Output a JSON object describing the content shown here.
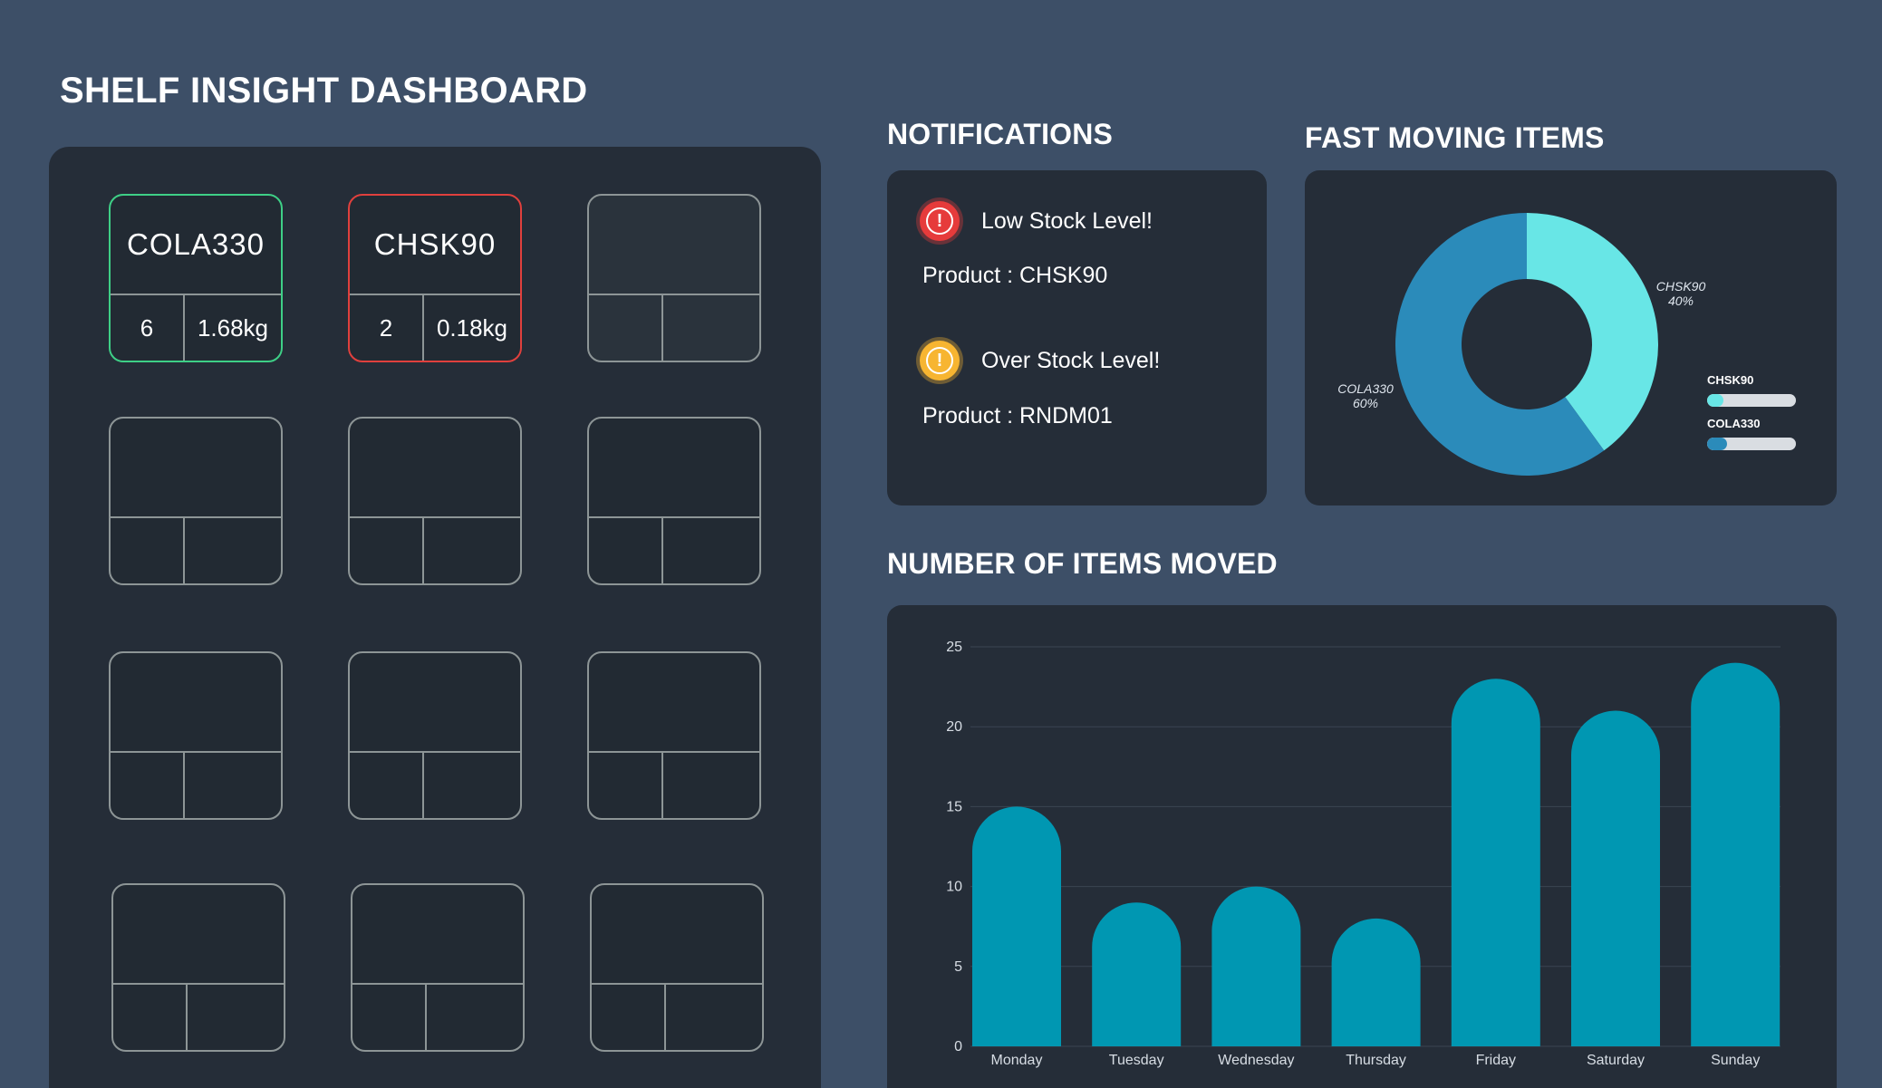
{
  "dashboard": {
    "title": "SHELF INSIGHT DASHBOARD"
  },
  "shelves": [
    {
      "code": "COLA330",
      "count": "6",
      "weight": "1.68kg",
      "status": "ok"
    },
    {
      "code": "CHSK90",
      "count": "2",
      "weight": "0.18kg",
      "status": "alert"
    },
    {
      "code": "",
      "count": "",
      "weight": "",
      "status": "empty"
    },
    {
      "code": "",
      "count": "",
      "weight": "",
      "status": "empty"
    },
    {
      "code": "",
      "count": "",
      "weight": "",
      "status": "empty"
    },
    {
      "code": "",
      "count": "",
      "weight": "",
      "status": "empty"
    },
    {
      "code": "",
      "count": "",
      "weight": "",
      "status": "empty"
    },
    {
      "code": "",
      "count": "",
      "weight": "",
      "status": "empty"
    },
    {
      "code": "",
      "count": "",
      "weight": "",
      "status": "empty"
    },
    {
      "code": "",
      "count": "",
      "weight": "",
      "status": "empty"
    },
    {
      "code": "",
      "count": "",
      "weight": "",
      "status": "empty"
    },
    {
      "code": "",
      "count": "",
      "weight": "",
      "status": "empty"
    }
  ],
  "notifications": {
    "title": "NOTIFICATIONS",
    "items": [
      {
        "message": "Low Stock Level!",
        "product": "Product : CHSK90",
        "level": "red",
        "icon": "alert-icon"
      },
      {
        "message": "Over Stock Level!",
        "product": "Product : RNDM01",
        "level": "yellow",
        "icon": "alert-icon"
      }
    ]
  },
  "fast_moving": {
    "title": "FAST MOVING ITEMS",
    "slices": [
      {
        "name": "CHSK90",
        "percent": 40,
        "label": "40%",
        "color": "#68e6e6"
      },
      {
        "name": "COLA330",
        "percent": 60,
        "label": "60%",
        "color": "#2b8bba"
      }
    ]
  },
  "items_moved": {
    "title": "NUMBER OF ITEMS MOVED"
  },
  "colors": {
    "background": "#3d4f67",
    "panel": "#252d38",
    "ok": "#3ecf86",
    "alert": "#e0403d",
    "bar": "#0097b2"
  },
  "chart_data": {
    "type": "bar",
    "categories": [
      "Monday",
      "Tuesday",
      "Wednesday",
      "Thursday",
      "Friday",
      "Saturday",
      "Sunday"
    ],
    "values": [
      15,
      9,
      10,
      8,
      23,
      21,
      24
    ],
    "yticks": [
      0,
      5,
      10,
      15,
      20,
      25
    ],
    "ylim": [
      0,
      25
    ],
    "grid": true,
    "title": "",
    "xlabel": "",
    "ylabel": ""
  }
}
